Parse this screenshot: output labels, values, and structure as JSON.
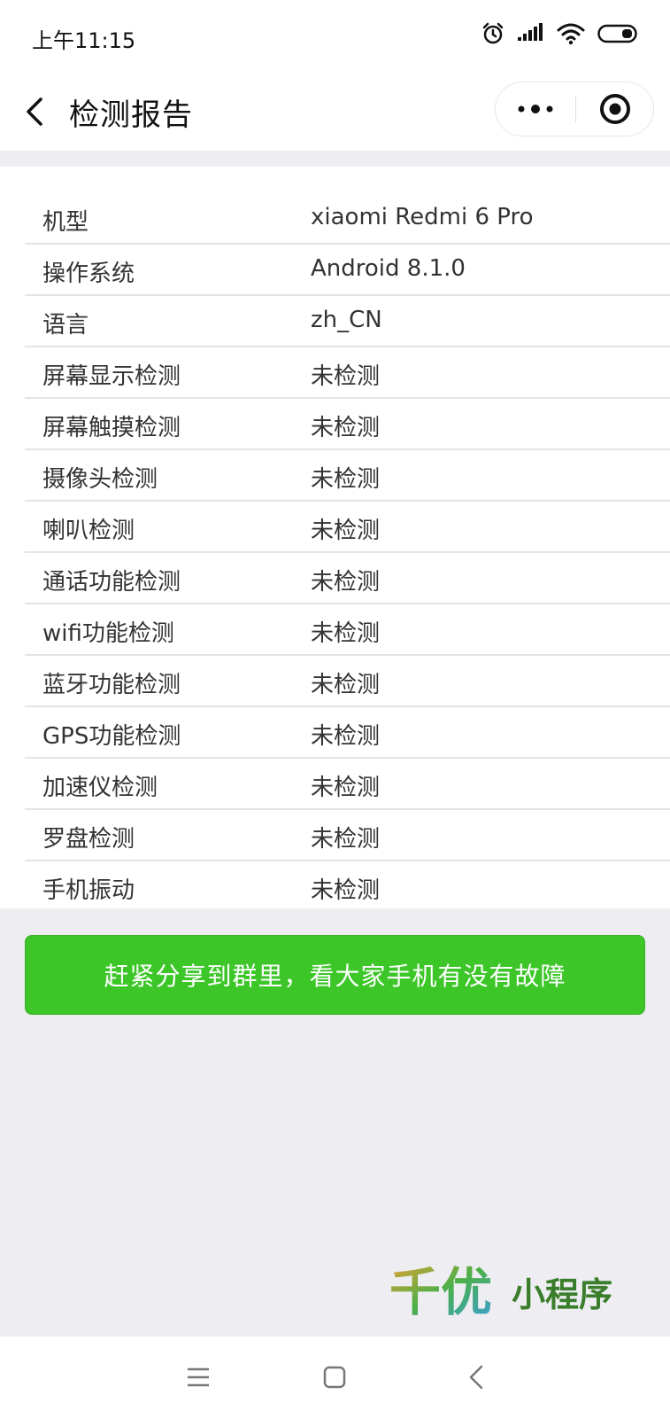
{
  "status_bar": {
    "time": "上午11:15",
    "icons": [
      "alarm-icon",
      "signal-icon",
      "wifi-icon",
      "battery-icon"
    ]
  },
  "nav": {
    "title": "检测报告",
    "more_icon": "more-dots-icon",
    "close_icon": "miniprogram-close-icon"
  },
  "report": {
    "rows": [
      {
        "label": "机型",
        "value": "xiaomi Redmi 6 Pro"
      },
      {
        "label": "操作系统",
        "value": "Android 8.1.0"
      },
      {
        "label": "语言",
        "value": "zh_CN"
      },
      {
        "label": "屏幕显示检测",
        "value": "未检测"
      },
      {
        "label": "屏幕触摸检测",
        "value": "未检测"
      },
      {
        "label": "摄像头检测",
        "value": "未检测"
      },
      {
        "label": "喇叭检测",
        "value": "未检测"
      },
      {
        "label": "通话功能检测",
        "value": "未检测"
      },
      {
        "label": "wifi功能检测",
        "value": "未检测"
      },
      {
        "label": "蓝牙功能检测",
        "value": "未检测"
      },
      {
        "label": "GPS功能检测",
        "value": "未检测"
      },
      {
        "label": "加速仪检测",
        "value": "未检测"
      },
      {
        "label": "罗盘检测",
        "value": "未检测"
      },
      {
        "label": "手机振动",
        "value": "未检测"
      }
    ]
  },
  "share_button": {
    "label": "赶紧分享到群里，看大家手机有没有故障",
    "color": "#3cc628"
  },
  "watermark": {
    "text": "千优小程序"
  },
  "bottom_nav": {
    "icons": [
      "menu-icon",
      "home-icon",
      "back-icon"
    ]
  }
}
